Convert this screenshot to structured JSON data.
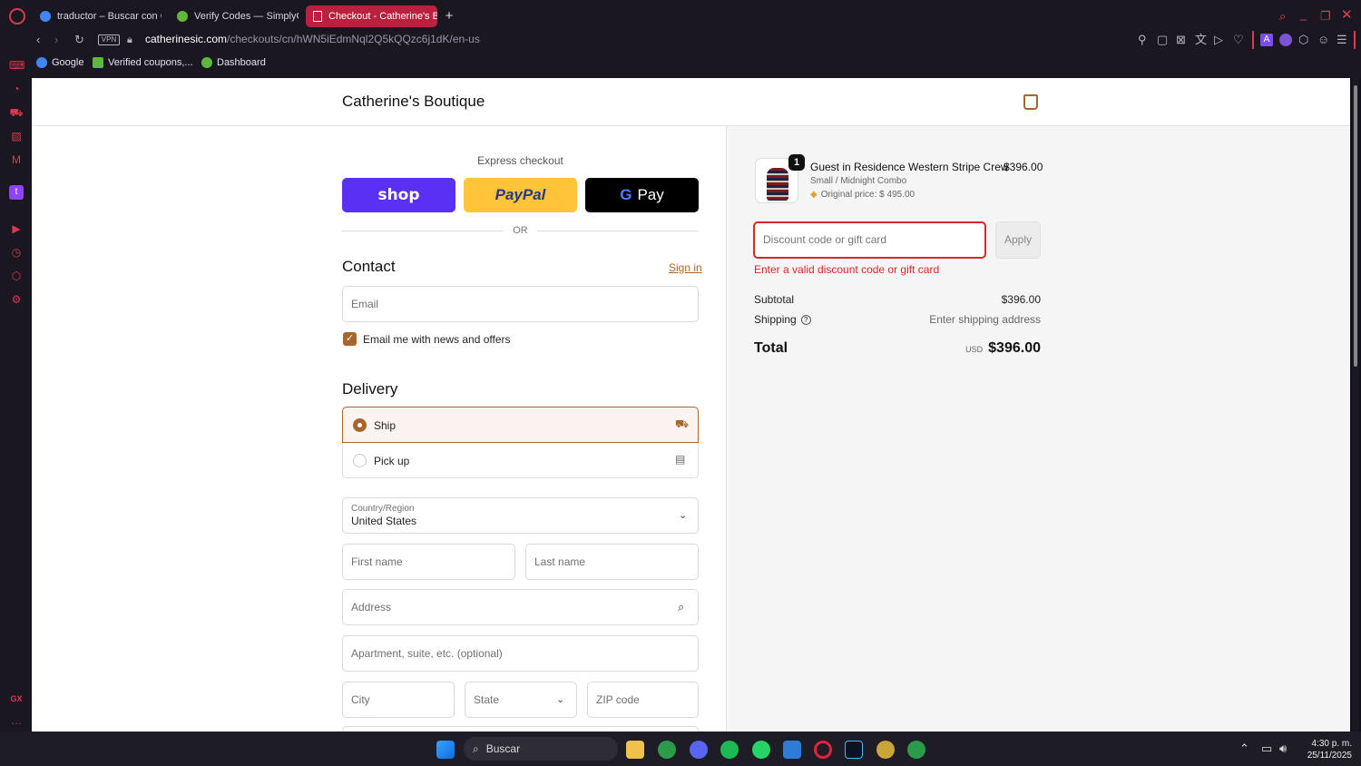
{
  "tabs": [
    {
      "label": "traductor – Buscar con Go"
    },
    {
      "label": "Verify Codes — SimplyCo"
    },
    {
      "label": "Checkout - Catherine's Bo"
    }
  ],
  "address": {
    "domain": "catherinesic.com",
    "path": "/checkouts/cn/hWN5iEdmNql2Q5kQQzc6j1dK/en-us",
    "vpn": "VPN"
  },
  "bookmarks": [
    "Google",
    "Verified coupons,...",
    "Dashboard"
  ],
  "store": {
    "name": "Catherine's Boutique"
  },
  "checkout": {
    "express_label": "Express checkout",
    "shop_label": "shop",
    "paypal_label": "PayPal",
    "gpay_label": "Pay",
    "or_label": "OR",
    "contact_title": "Contact",
    "sign_in": "Sign in",
    "email_placeholder": "Email",
    "newsletter_label": "Email me with news and offers",
    "delivery_title": "Delivery",
    "ship_label": "Ship",
    "pickup_label": "Pick up",
    "country_label": "Country/Region",
    "country_value": "United States",
    "first_name": "First name",
    "last_name": "Last name",
    "address_placeholder": "Address",
    "apartment_placeholder": "Apartment, suite, etc. (optional)",
    "city": "City",
    "state": "State",
    "zip": "ZIP code"
  },
  "summary": {
    "item_qty": "1",
    "item_name": "Guest in Residence Western Stripe Crew",
    "item_variant": "Small / Midnight Combo",
    "item_original": "Original price: $ 495.00",
    "item_price": "$396.00",
    "discount_placeholder": "Discount code or gift card",
    "apply": "Apply",
    "discount_error": "Enter a valid discount code or gift card",
    "subtotal_label": "Subtotal",
    "subtotal_value": "$396.00",
    "shipping_label": "Shipping",
    "shipping_value": "Enter shipping address",
    "total_label": "Total",
    "total_currency": "USD",
    "total_value": "$396.00"
  },
  "taskbar": {
    "search": "Buscar",
    "time": "4:30 p. m.",
    "date": "25/11/2025"
  },
  "colors": {
    "accent": "#a9662b",
    "error": "#d8262c",
    "shop": "#5a31f4",
    "paypal": "#ffc43a",
    "active_tab": "#b9213f"
  }
}
